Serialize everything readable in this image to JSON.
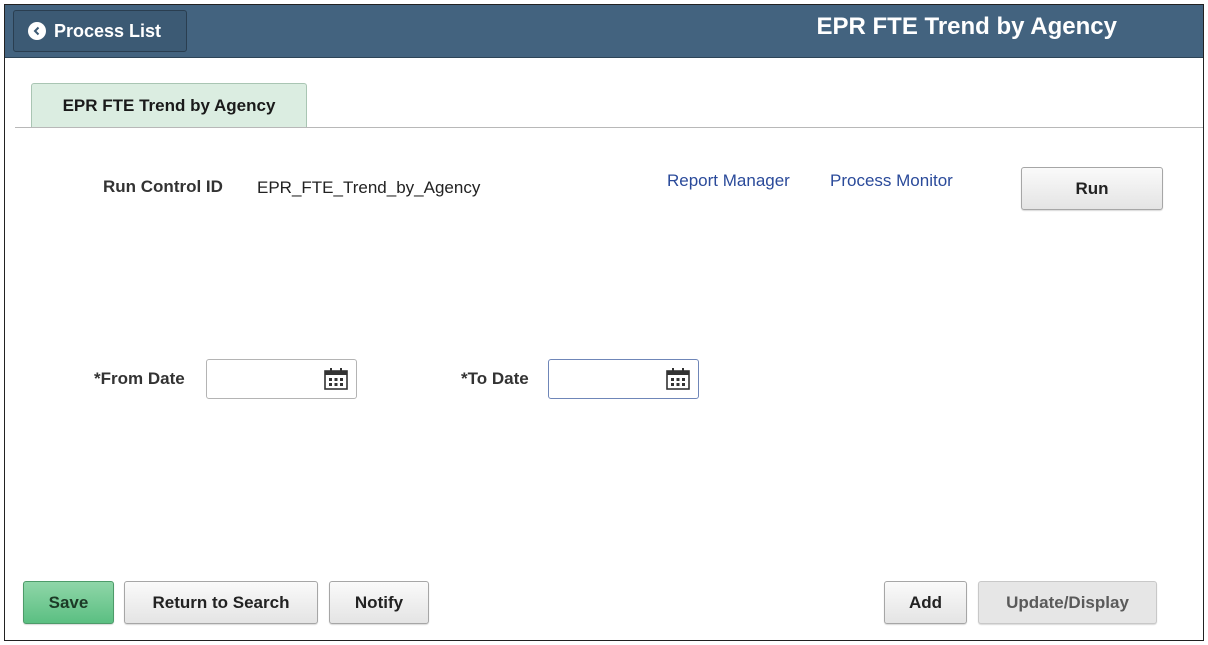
{
  "header": {
    "back_label": "Process List",
    "title": "EPR FTE Trend by Agency"
  },
  "tab": {
    "label": "EPR FTE Trend by Agency"
  },
  "run_control": {
    "label": "Run Control ID",
    "value": "EPR_FTE_Trend_by_Agency"
  },
  "links": {
    "report_manager": "Report Manager",
    "process_monitor": "Process Monitor"
  },
  "run_button": "Run",
  "from_date": {
    "label": "*From Date",
    "value": ""
  },
  "to_date": {
    "label": "*To Date",
    "value": ""
  },
  "footer": {
    "save": "Save",
    "return_to_search": "Return to Search",
    "notify": "Notify",
    "add": "Add",
    "update_display": "Update/Display"
  },
  "icons": {
    "back": "chevron-left-icon",
    "calendar": "calendar-icon"
  },
  "colors": {
    "header_bg": "#43637f",
    "tab_bg": "#dbede1",
    "primary_button": "#5bbf82",
    "link": "#2a4a9a"
  }
}
